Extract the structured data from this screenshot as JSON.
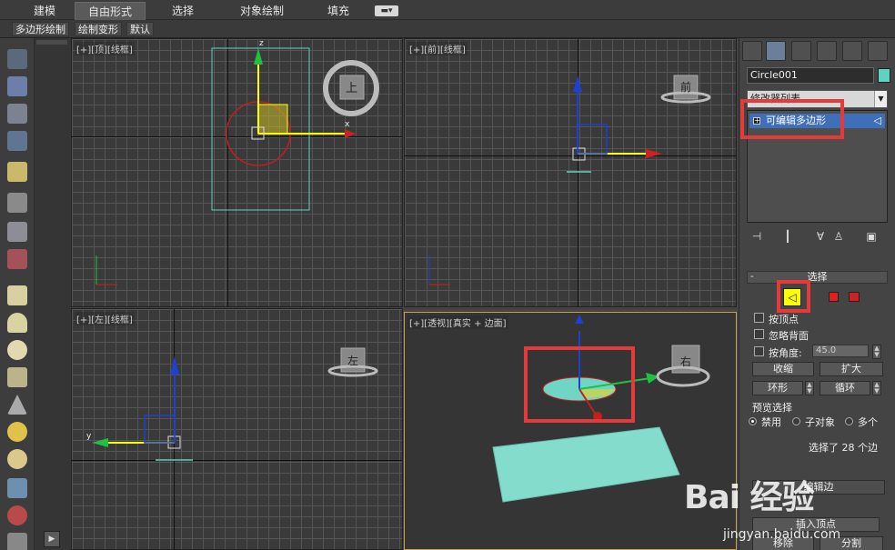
{
  "ribbon": {
    "tabs": [
      "建模",
      "自由形式",
      "选择",
      "对象绘制",
      "填充"
    ],
    "active": "自由形式"
  },
  "subtoolbar": [
    "多边形绘制",
    "绘制变形",
    "默认"
  ],
  "viewports": {
    "top": {
      "label": "[+][顶][线框]",
      "cube": "上"
    },
    "front": {
      "label": "[+][前][线框]",
      "cube": "前"
    },
    "left": {
      "label": "[+][左][线框]",
      "cube": "左"
    },
    "perspective": {
      "label": "[+][透视][真实 + 边面]",
      "cube": "右"
    }
  },
  "axes": {
    "x": "x",
    "y": "y",
    "z": "z"
  },
  "command_panel": {
    "object_name": "Circle001",
    "object_color": "#5fd3c2",
    "modifier_list": "修改器列表",
    "stack_item": "可编辑多边形",
    "rollout_title": "选择",
    "options": {
      "by_vertex": "按顶点",
      "ignore_backfacing": "忽略背面",
      "by_angle": "按角度:",
      "angle_value": "45.0"
    },
    "buttons": {
      "shrink": "收缩",
      "grow": "扩大",
      "ring": "环形",
      "loop": "循环"
    },
    "preview": {
      "title": "预览选择",
      "disabled": "禁用",
      "subobject": "子对象",
      "multi": "多个"
    },
    "status": "选择了 28 个边",
    "more_buttons": {
      "edit_edges": "编辑边",
      "insert_vertex": "插入顶点",
      "remove": "移除",
      "split": "分割"
    }
  },
  "colors": {
    "highlight_red": "#e53a3a",
    "selection_blue": "#3f6fb8",
    "mesh_cyan": "#7fd6c8",
    "subobject_yellow": "#ffff00"
  },
  "watermark": {
    "logo": "Bai 经验",
    "url": "jingyan.baidu.com"
  }
}
